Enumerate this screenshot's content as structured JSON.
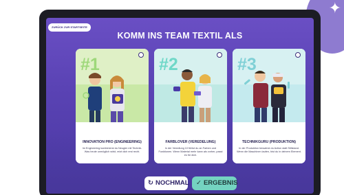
{
  "corner_icon": "sparkle-icon",
  "screen": {
    "back_label": "ZURÜCK ZUR STARTSEITE",
    "title": "KOMM INS TEAM TEXTIL ALS"
  },
  "cards": [
    {
      "number": "#1",
      "title": "INNOVATION PRO (ENGINEERING)",
      "description": "Im Engineering kombinierst du Neugier mit Technik. Was heute unmöglich wirkt, reizt dich erst recht.",
      "accent": "#9ed87a"
    },
    {
      "number": "#2",
      "title": "FARBLOVER (VEREDELUNG)",
      "description": "In der Veredlung 10 fühlst du an Farben und Funktionen. Wenn Material mehr kann als vorher, passt es für dich.",
      "accent": "#6fd8c8"
    },
    {
      "number": "#3",
      "title": "TECHNIKGURU (PRODUKTION)",
      "description": "In der Produktion bewahrst du Action statt Stillstand. Wenn die Maschinen laufen, bist du in deinem Element.",
      "accent": "#7fd0d6"
    }
  ],
  "buttons": {
    "again": "NOCHMAL",
    "again_icon": "refresh-icon",
    "result": "ERGEBNIS",
    "result_icon": "check-icon"
  }
}
